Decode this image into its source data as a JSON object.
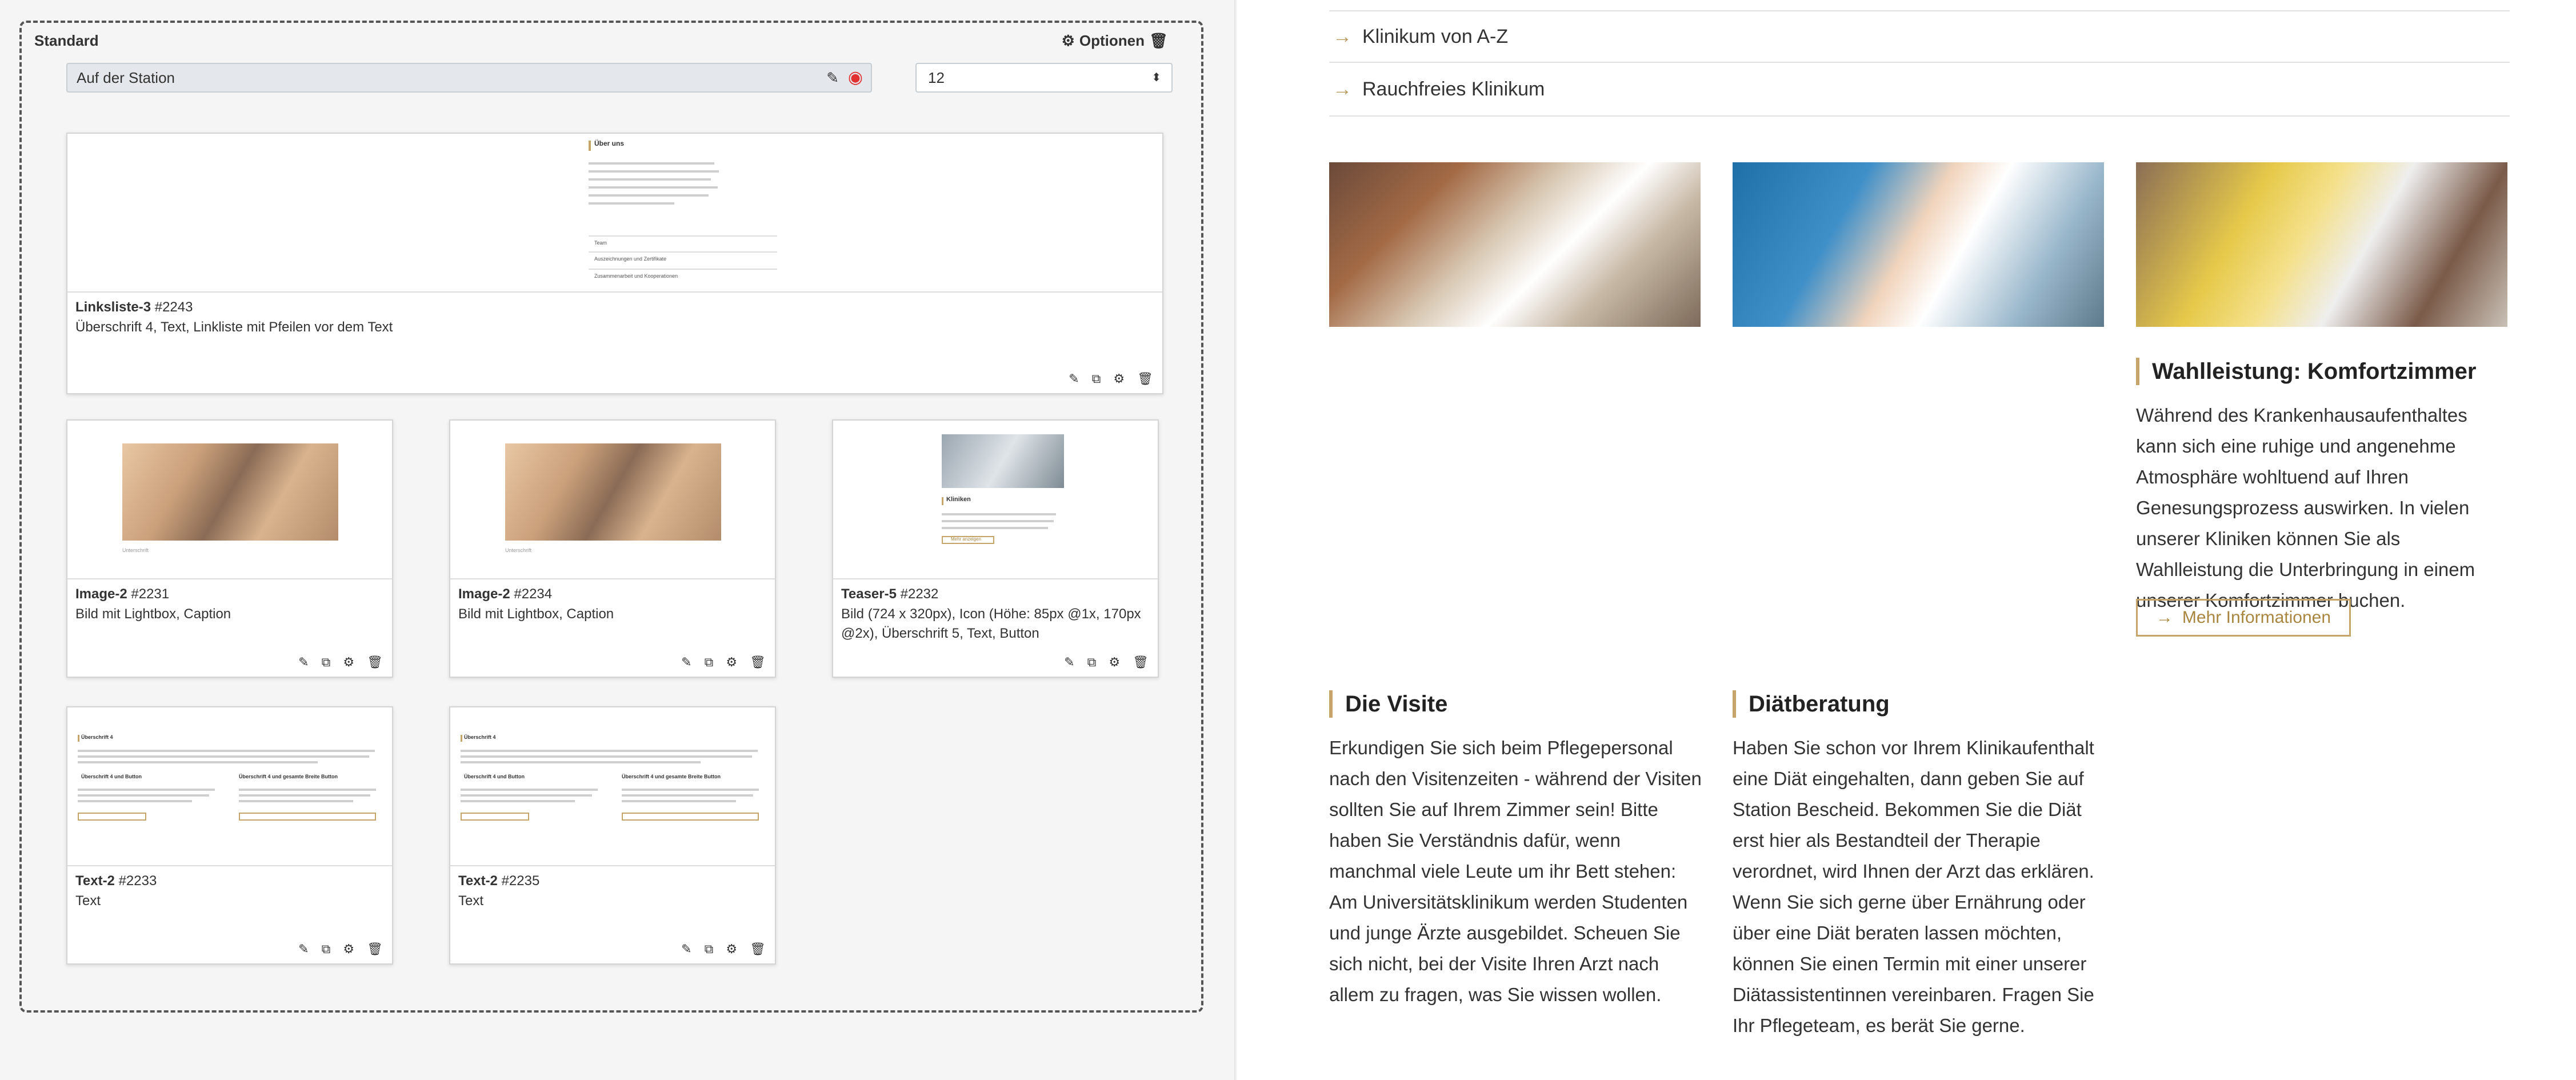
{
  "editor": {
    "section_title": "Standard",
    "options_label": "Optionen",
    "name_value": "Auf der Station",
    "columns_value": "12",
    "cards": [
      {
        "title": "Linksliste-3",
        "id": "#2243",
        "desc": "Überschrift 4, Text, Linkliste mit Pfeilen vor dem Text",
        "preview": {
          "heading": "Über uns",
          "links": [
            "Team",
            "Auszeichnungen und Zertifikate",
            "Zusammenarbeit und Kooperationen"
          ]
        }
      },
      {
        "title": "Image-2",
        "id": "#2231",
        "desc": "Bild mit Lightbox, Caption",
        "preview": {
          "caption": "Unterschrift"
        }
      },
      {
        "title": "Image-2",
        "id": "#2234",
        "desc": "Bild mit Lightbox, Caption",
        "preview": {
          "caption": "Unterschrift"
        }
      },
      {
        "title": "Teaser-5",
        "id": "#2232",
        "desc": "Bild (724 x 320px), Icon (Höhe: 85px @1x, 170px @2x), Überschrift 5, Text, Button",
        "preview": {
          "heading": "Kliniken",
          "button": "Mehr anzeigen"
        }
      },
      {
        "title": "Text-2",
        "id": "#2233",
        "desc": "Text",
        "preview": {
          "heading": "Überschrift 4",
          "col1": "Überschrift 4 und Button",
          "col2": "Überschrift 4 und gesamte Breite Button"
        }
      },
      {
        "title": "Text-2",
        "id": "#2235",
        "desc": "Text",
        "preview": {
          "heading": "Überschrift 4",
          "col1": "Überschrift 4 und Button",
          "col2": "Überschrift 4 und gesamte Breite Button"
        }
      }
    ]
  },
  "site": {
    "links": [
      "Klinikum von A-Z",
      "Rauchfreies Klinikum"
    ],
    "blocks": [
      {
        "heading": "Wahlleistung: Komfortzimmer",
        "text": "Während des Krankenhausaufenthaltes kann sich eine ruhige und angenehme Atmosphäre wohltuend auf Ihren Genesungsprozess auswirken. In vielen unserer Kliniken können Sie als Wahlleistung die Unterbringung in einem unserer Komfortzimmer buchen.",
        "button": "Mehr Informationen"
      },
      {
        "heading": "Die Visite",
        "text": "Erkundigen Sie sich beim Pflegepersonal nach den Visitenzeiten - während der Visiten sollten Sie auf Ihrem Zimmer sein! Bitte haben Sie Verständnis dafür, wenn manchmal viele Leute um ihr Bett stehen: Am Universitätsklinikum werden Studenten und junge Ärzte ausgebildet. Scheuen Sie sich nicht, bei der Visite Ihren Arzt nach allem zu fragen, was Sie wissen wollen."
      },
      {
        "heading": "Diätberatung",
        "text": "Haben Sie schon vor Ihrem Klinikaufenthalt eine Diät eingehalten, dann geben Sie auf Station Bescheid. Bekommen Sie die Diät erst hier als Bestandteil der Therapie verordnet, wird Ihnen der Arzt das erklären. Wenn Sie sich gerne über Ernährung oder über eine Diät beraten lassen möchten, können Sie einen Termin mit einer unserer Diätassistentinnen vereinbaren. Fragen Sie Ihr Pflegeteam, es berät Sie gerne."
      }
    ]
  }
}
